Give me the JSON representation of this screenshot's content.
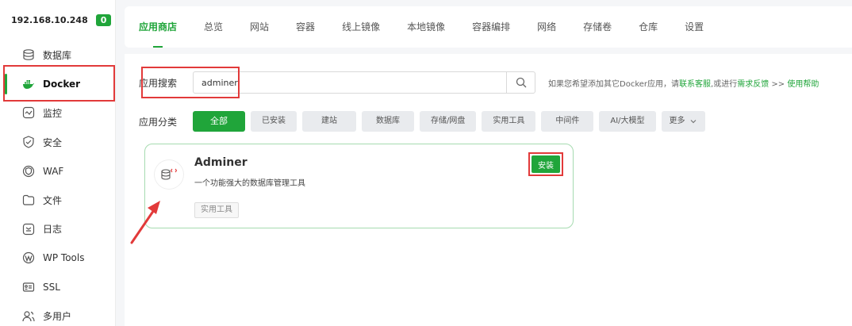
{
  "sidebar": {
    "host_ip": "192.168.10.248",
    "host_badge": "0",
    "items": [
      {
        "label": "数据库",
        "icon": "database-icon"
      },
      {
        "label": "Docker",
        "icon": "docker-icon"
      },
      {
        "label": "监控",
        "icon": "monitor-icon"
      },
      {
        "label": "安全",
        "icon": "shield-check-icon"
      },
      {
        "label": "WAF",
        "icon": "waf-icon"
      },
      {
        "label": "文件",
        "icon": "folder-icon"
      },
      {
        "label": "日志",
        "icon": "log-icon"
      },
      {
        "label": "WP Tools",
        "icon": "wordpress-icon"
      },
      {
        "label": "SSL",
        "icon": "ssl-icon"
      },
      {
        "label": "多用户",
        "icon": "users-icon"
      }
    ],
    "active_index": 1
  },
  "tabs": [
    "应用商店",
    "总览",
    "网站",
    "容器",
    "线上镜像",
    "本地镜像",
    "容器编排",
    "网络",
    "存储卷",
    "仓库",
    "设置"
  ],
  "search": {
    "label": "应用搜索",
    "value": "adminer",
    "hint_prefix": "如果您希望添加其它Docker应用，请",
    "hint_link1": "联系客服",
    "hint_mid": ",或进行",
    "hint_link2": "需求反馈",
    "hint_sep": " >> ",
    "hint_link3": "使用帮助"
  },
  "categories": {
    "label": "应用分类",
    "items": [
      "全部",
      "已安装",
      "建站",
      "数据库",
      "存储/网盘",
      "实用工具",
      "中间件",
      "AI/大模型",
      "更多"
    ],
    "active_index": 0
  },
  "app": {
    "name": "Adminer",
    "description": "一个功能强大的数据库管理工具",
    "tag": "实用工具",
    "install_label": "安装"
  },
  "colors": {
    "accent": "#20a53a",
    "highlight": "#e23a3a"
  }
}
